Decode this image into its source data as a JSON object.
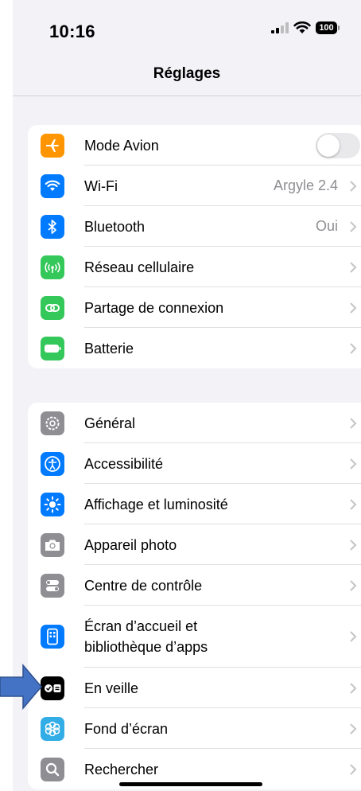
{
  "status_bar": {
    "time": "10:16",
    "battery": "100"
  },
  "nav": {
    "title": "Réglages"
  },
  "group1": [
    {
      "label": "Mode Avion",
      "icon": "airplane-icon",
      "color": "#ff9500",
      "toggle": false
    },
    {
      "label": "Wi-Fi",
      "icon": "wifi-icon",
      "color": "#007aff",
      "value": "Argyle 2.4"
    },
    {
      "label": "Bluetooth",
      "icon": "bluetooth-icon",
      "color": "#007aff",
      "value": "Oui"
    },
    {
      "label": "Réseau cellulaire",
      "icon": "cellular-icon",
      "color": "#34c759"
    },
    {
      "label": "Partage de connexion",
      "icon": "hotspot-icon",
      "color": "#34c759"
    },
    {
      "label": "Batterie",
      "icon": "battery-icon",
      "color": "#34c759"
    }
  ],
  "group2": [
    {
      "label": "Général",
      "icon": "gear-icon",
      "color": "#8e8e93"
    },
    {
      "label": "Accessibilité",
      "icon": "accessibility-icon",
      "color": "#007aff"
    },
    {
      "label": "Affichage et luminosité",
      "icon": "brightness-icon",
      "color": "#007aff"
    },
    {
      "label": "Appareil photo",
      "icon": "camera-icon",
      "color": "#8e8e93"
    },
    {
      "label": "Centre de contrôle",
      "icon": "control-center-icon",
      "color": "#8e8e93"
    },
    {
      "label_line1": "Écran d’accueil et",
      "label_line2": "bibliothèque d’apps",
      "icon": "home-screen-icon",
      "color": "#007aff"
    },
    {
      "label": "En veille",
      "icon": "standby-icon",
      "color": "#000000"
    },
    {
      "label": "Fond d’écran",
      "icon": "wallpaper-icon",
      "color": "#32ade6"
    },
    {
      "label": "Rechercher",
      "icon": "search-icon",
      "color": "#8e8e93"
    }
  ],
  "annotation": {
    "arrow_color": "#4472c4"
  }
}
